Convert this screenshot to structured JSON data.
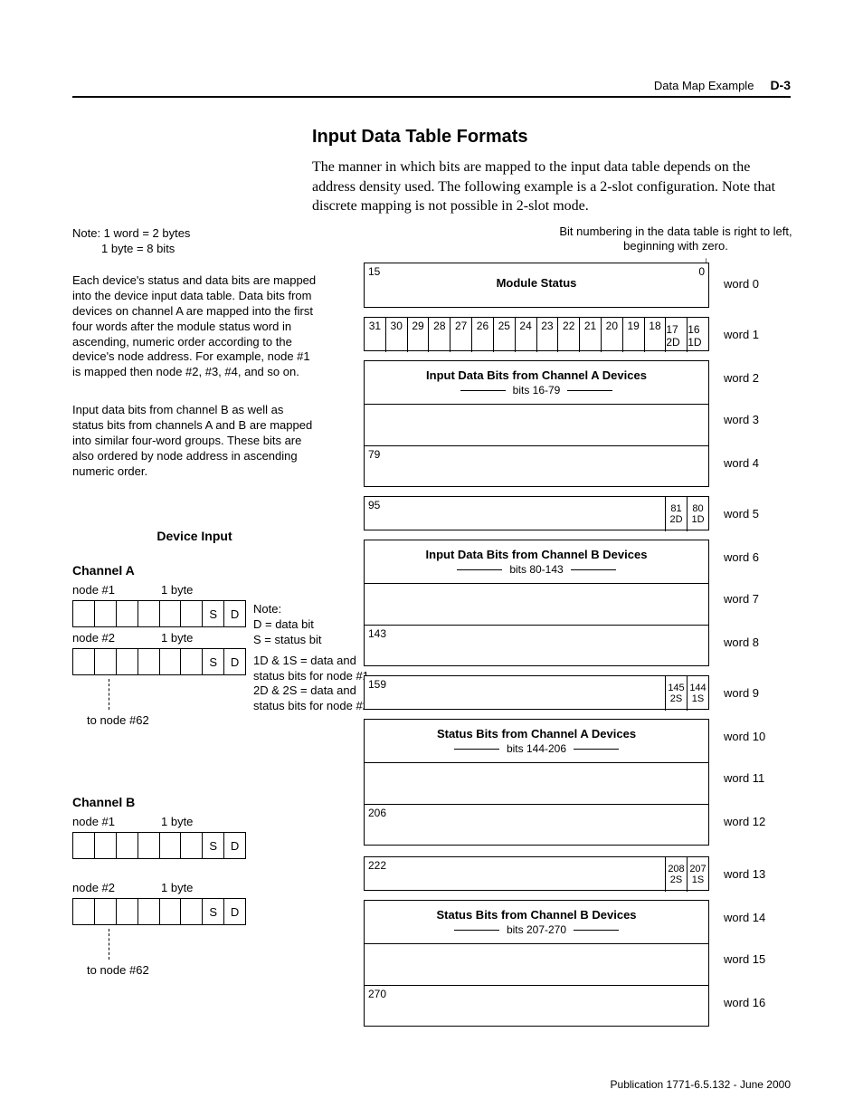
{
  "header": {
    "title": "Data Map Example",
    "pagenum": "D-3"
  },
  "section_title": "Input Data Table Formats",
  "intro": "The manner in which bits are mapped to the input data table depends on the address density used. The following example is a 2-slot configuration. Note that discrete mapping is not possible in 2-slot mode.",
  "side": {
    "note_line1": "Note: 1 word = 2 bytes",
    "note_line2": "1 byte = 8 bits",
    "para1": "Each device's status and data bits are mapped into the device input data table. Data bits from devices on channel A are mapped into the first four words after the module status word in ascending, numeric order according to the device's node address. For example, node #1 is mapped then node #2, #3, #4, and so on.",
    "para2": "Input data bits from channel B as well as status bits from channels A and B are mapped into similar four-word groups. These bits are also ordered by node address in ascending numeric order.",
    "devinput": "Device Input"
  },
  "channels": {
    "a_title": "Channel A",
    "b_title": "Channel B",
    "node1": "node #1",
    "node2": "node #2",
    "bytesize": "1 byte",
    "to_node": "to node #62",
    "S": "S",
    "D": "D"
  },
  "legend": {
    "note": "Note:",
    "d": "D = data bit",
    "s": "S = status bit",
    "l1": "1D & 1S = data and status bits for node #1",
    "l2": "2D & 2S = data and status bits for node #2"
  },
  "diagram": {
    "bit_note": "Bit numbering in the data table is right to left, beginning with zero.",
    "bits_top31": [
      "31",
      "30",
      "29",
      "28",
      "27",
      "26",
      "25",
      "24",
      "23",
      "22",
      "21",
      "20",
      "19",
      "18"
    ],
    "module_status": "Module Status",
    "ms_left": "15",
    "ms_right": "0",
    "cell_17": "17",
    "cell_16": "16",
    "cell_2d": "2D",
    "cell_1d": "1D",
    "grpA_title": "Input Data Bits from Channel A Devices",
    "grpA_bits": "bits 16-79",
    "cell_79": "79",
    "cell_95": "95",
    "cell_81": "81",
    "cell_80": "80",
    "grpB_title": "Input Data Bits from Channel B Devices",
    "grpB_bits": "bits 80-143",
    "cell_143": "143",
    "cell_159": "159",
    "cell_145": "145",
    "cell_144": "144",
    "cell_2s": "2S",
    "cell_1s": "1S",
    "grpSA_title": "Status Bits from Channel A Devices",
    "grpSA_bits": "bits 144-206",
    "cell_206": "206",
    "cell_222": "222",
    "cell_208": "208",
    "cell_207": "207",
    "grpSB_title": "Status Bits from Channel B Devices",
    "grpSB_bits": "bits 207-270",
    "cell_270": "270",
    "words": [
      "word 0",
      "word 1",
      "word 2",
      "word 3",
      "word 4",
      "word 5",
      "word 6",
      "word 7",
      "word 8",
      "word 9",
      "word 10",
      "word 11",
      "word 12",
      "word 13",
      "word 14",
      "word 15",
      "word 16"
    ]
  },
  "footer": "Publication 1771-6.5.132 - June 2000"
}
